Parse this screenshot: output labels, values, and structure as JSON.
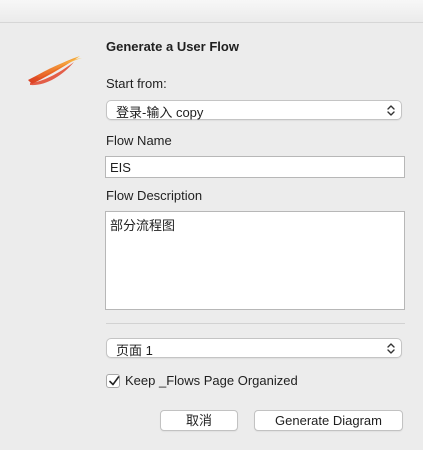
{
  "dialog": {
    "title": "Generate a User Flow",
    "start_from": {
      "label": "Start from:",
      "selected": "登录-输入 copy"
    },
    "flow_name": {
      "label": "Flow Name",
      "value": "EIS"
    },
    "flow_description": {
      "label": "Flow Description",
      "value": "部分流程图"
    },
    "page_select": {
      "selected": "页面 1"
    },
    "keep_organized": {
      "label": "Keep _Flows Page Organized",
      "checked": true
    },
    "buttons": {
      "cancel": "取消",
      "generate": "Generate Diagram"
    }
  },
  "icons": {
    "app_logo": "sketch-logo-flame",
    "popup_arrows": "up-down-chevron-icon",
    "checkmark": "checkmark-icon"
  },
  "colors": {
    "window_bg": "#ececec",
    "logo_orange": "#f08a24",
    "logo_red": "#e2452b"
  }
}
